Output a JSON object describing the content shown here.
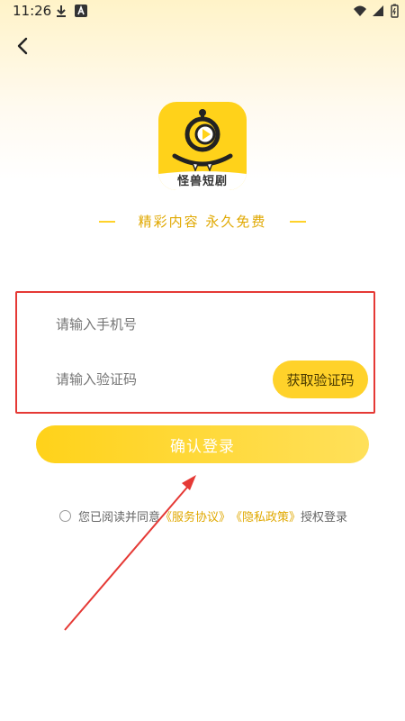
{
  "status_bar": {
    "time": "11:26"
  },
  "logo": {
    "text": "怪兽短剧"
  },
  "slogan": "精彩内容  永久免费",
  "phone_field": {
    "placeholder": "请输入手机号"
  },
  "code_field": {
    "placeholder": "请输入验证码"
  },
  "get_code_label": "获取验证码",
  "login_label": "确认登录",
  "agreement": {
    "prefix": "您已阅读并同意",
    "service_link": "《服务协议》",
    "privacy_link": "《隐私政策》",
    "suffix": "授权登录"
  },
  "colors": {
    "brand_yellow": "#ffd21a",
    "link_gold": "#e0a800",
    "annotation_red": "#e53935"
  },
  "icons": {
    "back": "back-arrow-icon",
    "download": "download-icon",
    "wifi": "wifi-icon",
    "signal": "signal-icon",
    "battery": "battery-icon"
  }
}
